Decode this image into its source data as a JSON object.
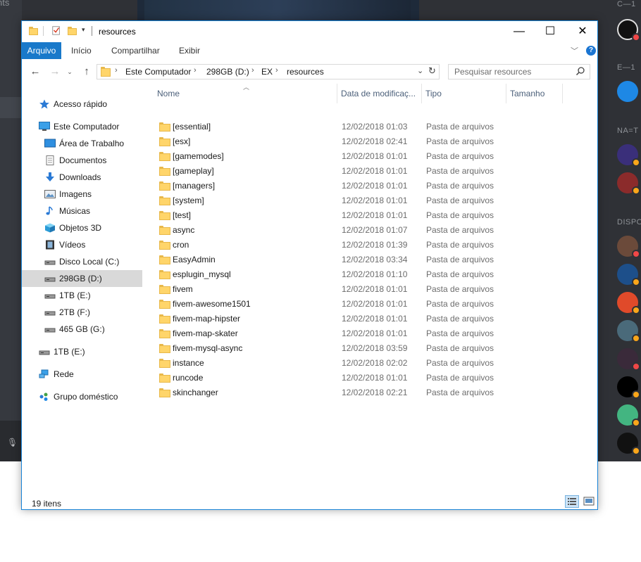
{
  "window": {
    "title": "resources",
    "controls": {
      "minimize": "—",
      "maximize": "☐",
      "close": "✕"
    }
  },
  "ribbon": {
    "tabs": [
      {
        "label": "Arquivo"
      },
      {
        "label": "Início"
      },
      {
        "label": "Compartilhar"
      },
      {
        "label": "Exibir"
      }
    ]
  },
  "navigation": {
    "breadcrumb": [
      "Este Computador",
      "298GB (D:)",
      "EX",
      "resources"
    ],
    "search_placeholder": "Pesquisar resources"
  },
  "sidebar": {
    "items": [
      {
        "label": "Acesso rápido",
        "icon": "star-icon"
      },
      {
        "label": "Este Computador",
        "icon": "computer-icon"
      },
      {
        "label": "Área de Trabalho",
        "icon": "desktop-icon"
      },
      {
        "label": "Documentos",
        "icon": "documents-icon"
      },
      {
        "label": "Downloads",
        "icon": "download-icon"
      },
      {
        "label": "Imagens",
        "icon": "images-icon"
      },
      {
        "label": "Músicas",
        "icon": "music-icon"
      },
      {
        "label": "Objetos 3D",
        "icon": "cube-icon"
      },
      {
        "label": "Vídeos",
        "icon": "video-icon"
      },
      {
        "label": "Disco Local (C:)",
        "icon": "drive-icon"
      },
      {
        "label": "298GB (D:)",
        "icon": "drive-icon",
        "selected": true
      },
      {
        "label": "1TB (E:)",
        "icon": "drive-icon"
      },
      {
        "label": "2TB (F:)",
        "icon": "drive-icon"
      },
      {
        "label": "465 GB (G:)",
        "icon": "drive-icon"
      },
      {
        "label": "1TB (E:)",
        "icon": "drive-icon"
      },
      {
        "label": "Rede",
        "icon": "network-icon"
      },
      {
        "label": "Grupo doméstico",
        "icon": "homegroup-icon"
      }
    ]
  },
  "columns": {
    "name": "Nome",
    "date": "Data de modificaç...",
    "type": "Tipo",
    "size": "Tamanho"
  },
  "files": [
    {
      "name": "[essential]",
      "date": "12/02/2018 01:03",
      "type": "Pasta de arquivos"
    },
    {
      "name": "[esx]",
      "date": "12/02/2018 02:41",
      "type": "Pasta de arquivos"
    },
    {
      "name": "[gamemodes]",
      "date": "12/02/2018 01:01",
      "type": "Pasta de arquivos"
    },
    {
      "name": "[gameplay]",
      "date": "12/02/2018 01:01",
      "type": "Pasta de arquivos"
    },
    {
      "name": "[managers]",
      "date": "12/02/2018 01:01",
      "type": "Pasta de arquivos"
    },
    {
      "name": "[system]",
      "date": "12/02/2018 01:01",
      "type": "Pasta de arquivos"
    },
    {
      "name": "[test]",
      "date": "12/02/2018 01:01",
      "type": "Pasta de arquivos"
    },
    {
      "name": "async",
      "date": "12/02/2018 01:07",
      "type": "Pasta de arquivos"
    },
    {
      "name": "cron",
      "date": "12/02/2018 01:39",
      "type": "Pasta de arquivos"
    },
    {
      "name": "EasyAdmin",
      "date": "12/02/2018 03:34",
      "type": "Pasta de arquivos"
    },
    {
      "name": "esplugin_mysql",
      "date": "12/02/2018 01:10",
      "type": "Pasta de arquivos"
    },
    {
      "name": "fivem",
      "date": "12/02/2018 01:01",
      "type": "Pasta de arquivos"
    },
    {
      "name": "fivem-awesome1501",
      "date": "12/02/2018 01:01",
      "type": "Pasta de arquivos"
    },
    {
      "name": "fivem-map-hipster",
      "date": "12/02/2018 01:01",
      "type": "Pasta de arquivos"
    },
    {
      "name": "fivem-map-skater",
      "date": "12/02/2018 01:01",
      "type": "Pasta de arquivos"
    },
    {
      "name": "fivem-mysql-async",
      "date": "12/02/2018 03:59",
      "type": "Pasta de arquivos"
    },
    {
      "name": "instance",
      "date": "12/02/2018 02:02",
      "type": "Pasta de arquivos"
    },
    {
      "name": "runcode",
      "date": "12/02/2018 01:01",
      "type": "Pasta de arquivos"
    },
    {
      "name": "skinchanger",
      "date": "12/02/2018 02:21",
      "type": "Pasta de arquivos"
    }
  ],
  "status": {
    "item_count": "19 itens"
  },
  "background": {
    "left_text": "nts",
    "right_labels": [
      "C—1",
      "E—1",
      "NA=T",
      "DISPO"
    ]
  }
}
